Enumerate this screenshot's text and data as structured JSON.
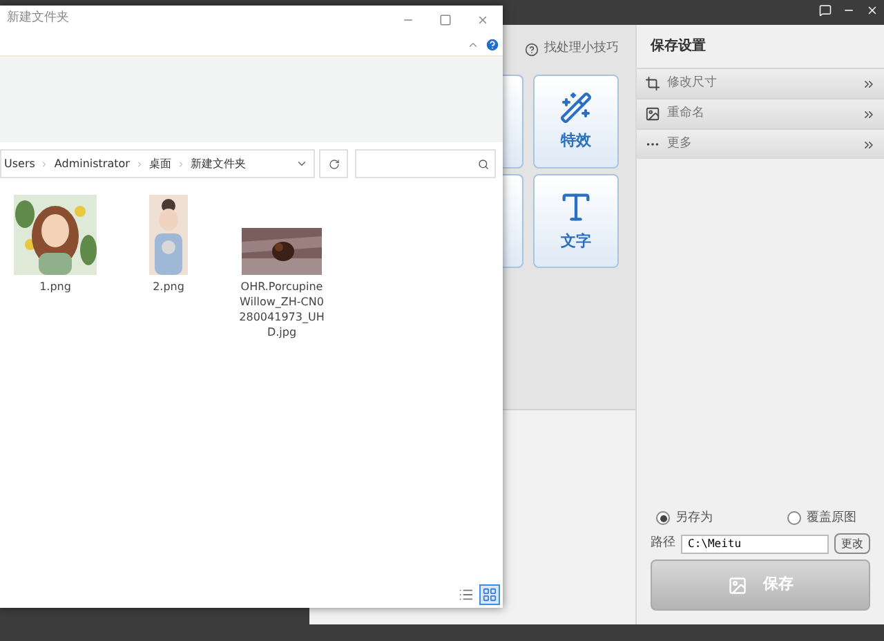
{
  "app": {
    "tip": "找处理小技巧",
    "tools": [
      {
        "label": "特效",
        "kind": "effects"
      },
      {
        "label": "文字",
        "kind": "text"
      }
    ],
    "settings": {
      "title": "保存设置",
      "sections": [
        {
          "label": "修改尺寸",
          "kind": "resize"
        },
        {
          "label": "重命名",
          "kind": "rename"
        },
        {
          "label": "更多",
          "kind": "more"
        }
      ],
      "save_mode": [
        {
          "label": "另存为",
          "selected": true
        },
        {
          "label": "覆盖原图",
          "selected": false
        }
      ],
      "path_label": "路径",
      "path": "C:\\Meitu",
      "change_button": "更改",
      "save_button": "保存"
    }
  },
  "dialog": {
    "title": "新建文件夹",
    "breadcrumb": [
      "Users",
      "Administrator",
      "桌面",
      "新建文件夹"
    ],
    "files": [
      {
        "name": "1.png",
        "kind": "portrait"
      },
      {
        "name": "2.png",
        "kind": "tall"
      },
      {
        "name": "OHR.PorcupineWillow_ZH-CN0280041973_UHD.jpg"
      }
    ],
    "views": [
      {
        "kind": "details",
        "selected": false
      },
      {
        "kind": "large",
        "selected": true
      }
    ]
  }
}
